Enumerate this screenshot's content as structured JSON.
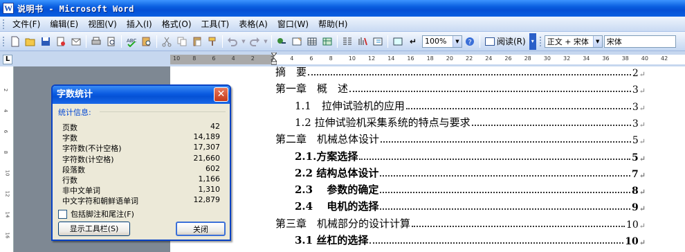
{
  "window": {
    "title": "说明书 - Microsoft Word"
  },
  "menu": [
    "文件(F)",
    "编辑(E)",
    "视图(V)",
    "插入(I)",
    "格式(O)",
    "工具(T)",
    "表格(A)",
    "窗口(W)",
    "帮助(H)"
  ],
  "toolbar": {
    "zoom": "100%",
    "read_label": "阅读(R)",
    "style_value": "正文 + 宋体",
    "font_value": "宋体"
  },
  "ruler": {
    "ticks": [
      "10",
      "8",
      "6",
      "4",
      "2",
      "2",
      "4",
      "6",
      "8",
      "10",
      "12",
      "14",
      "16",
      "18",
      "20",
      "22",
      "24",
      "26",
      "28",
      "30",
      "32",
      "34",
      "36",
      "38",
      "40",
      "42"
    ],
    "vticks": [
      "2",
      "4",
      "6",
      "8",
      "10",
      "12",
      "14",
      "16"
    ]
  },
  "document": {
    "toc": [
      {
        "text": "摘　要",
        "page": "2",
        "level": 0,
        "bold": false
      },
      {
        "text": "第一章　概　述",
        "page": "3",
        "level": 0,
        "bold": false
      },
      {
        "text": "1.1　拉伸试验机的应用",
        "page": "3",
        "level": 1,
        "bold": false
      },
      {
        "text": "1.2 拉伸试验机采集系统的特点与要求",
        "page": "3",
        "level": 1,
        "bold": false
      },
      {
        "text": "第二章　机械总体设计",
        "page": "5",
        "level": 0,
        "bold": false
      },
      {
        "text": "2.1.方案选择",
        "page": "5",
        "level": 1,
        "bold": true
      },
      {
        "text": "2.2  结构总体设计",
        "page": "7",
        "level": 1,
        "bold": true
      },
      {
        "text": "2.3　 参数的确定",
        "page": "8",
        "level": 1,
        "bold": true
      },
      {
        "text": "2.4　 电机的选择",
        "page": "9",
        "level": 1,
        "bold": true
      },
      {
        "text": "第三章　机械部分的设计计算",
        "page": "10",
        "level": 0,
        "bold": false
      },
      {
        "text": "3.1  丝杠的选择",
        "page": "10",
        "level": 1,
        "bold": true
      }
    ],
    "para_mark": "↵"
  },
  "dialog": {
    "title": "字数统计",
    "group_label": "统计信息:",
    "stats": [
      {
        "label": "页数",
        "value": "42"
      },
      {
        "label": "字数",
        "value": "14,189"
      },
      {
        "label": "字符数(不计空格)",
        "value": "17,307"
      },
      {
        "label": "字符数(计空格)",
        "value": "21,660"
      },
      {
        "label": "段落数",
        "value": "602"
      },
      {
        "label": "行数",
        "value": "1,166"
      },
      {
        "label": "非中文单词",
        "value": "1,310"
      },
      {
        "label": "中文字符和朝鲜语单词",
        "value": "12,879"
      }
    ],
    "checkbox_label": "包括脚注和尾注(F)",
    "checkbox_checked": false,
    "toolbar_button": "显示工具栏(S)",
    "close_button": "关闭"
  }
}
